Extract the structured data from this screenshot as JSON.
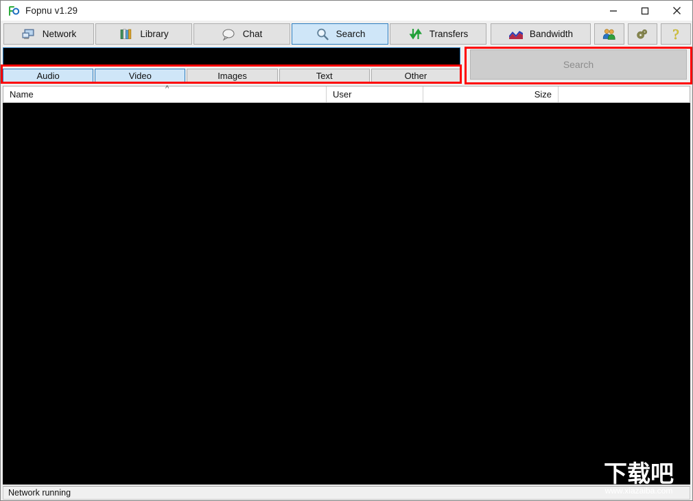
{
  "window": {
    "title": "Fopnu v1.29",
    "logo_icon": "fopnu-logo-icon",
    "controls": {
      "minimize_icon": "minimize-icon",
      "maximize_icon": "maximize-icon",
      "close_icon": "close-icon"
    }
  },
  "toolbar": {
    "buttons": [
      {
        "label": "Network",
        "icon": "computer-monitor-icon",
        "selected": false
      },
      {
        "label": "Library",
        "icon": "books-icon",
        "selected": false
      },
      {
        "label": "Chat",
        "icon": "speech-bubble-icon",
        "selected": false
      },
      {
        "label": "Search",
        "icon": "magnifier-icon",
        "selected": true
      },
      {
        "label": "Transfers",
        "icon": "up-down-arrows-icon",
        "selected": false
      },
      {
        "label": "Bandwidth",
        "icon": "area-chart-icon",
        "selected": false
      }
    ],
    "icon_buttons": [
      {
        "label": "",
        "icon": "users-people-icon"
      },
      {
        "label": "",
        "icon": "gear-settings-icon"
      },
      {
        "label": "",
        "icon": "question-mark-help-icon"
      }
    ]
  },
  "search": {
    "query": "",
    "placeholder": "",
    "button_label": "Search",
    "button_disabled": true,
    "tabs": [
      {
        "label": "Audio",
        "selected": true
      },
      {
        "label": "Video",
        "selected": true
      },
      {
        "label": "Images",
        "selected": false
      },
      {
        "label": "Text",
        "selected": false
      },
      {
        "label": "Other",
        "selected": false
      }
    ]
  },
  "results": {
    "columns": [
      {
        "label": "Name",
        "sort": "ascending",
        "sort_glyph": "^"
      },
      {
        "label": "User",
        "sort": "none",
        "sort_glyph": ""
      },
      {
        "label": "Size",
        "sort": "none",
        "sort_glyph": ""
      }
    ],
    "rows": []
  },
  "statusbar": {
    "text": "Network running"
  },
  "watermark": {
    "text": "下载吧",
    "url": "www.xiazaiba.com"
  },
  "colors": {
    "accent_blue": "#2a7bbd",
    "tab_selected_fill": "#cfe6f8",
    "annotation_red": "#fe0000",
    "list_background": "#000000",
    "chrome_gray": "#f0f0f0"
  }
}
